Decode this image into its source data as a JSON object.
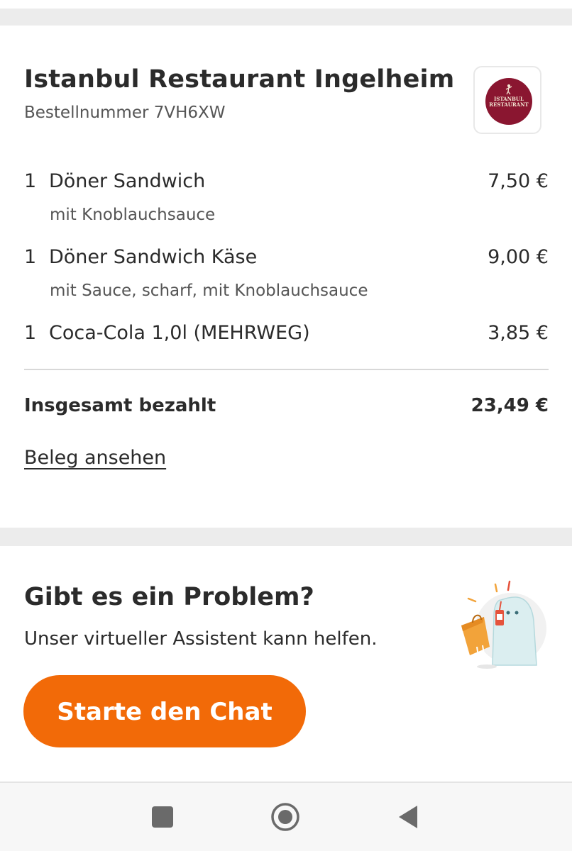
{
  "order": {
    "restaurant_name": "Istanbul Restaurant Ingelheim",
    "order_number_label": "Bestellnummer 7VH6XW",
    "logo_text_line1": "ISTANBUL",
    "logo_text_line2": "RESTAURANT",
    "items": [
      {
        "qty": "1",
        "name": "Döner Sandwich",
        "price": "7,50 €",
        "note": "mit Knoblauchsauce"
      },
      {
        "qty": "1",
        "name": "Döner Sandwich Käse",
        "price": "9,00 €",
        "note": "mit Sauce, scharf, mit Knoblauchsauce"
      },
      {
        "qty": "1",
        "name": "Coca-Cola 1,0l (MEHRWEG)",
        "price": "3,85 €",
        "note": ""
      }
    ],
    "total_label": "Insgesamt bezahlt",
    "total_value": "23,49 €",
    "receipt_link": "Beleg ansehen"
  },
  "help": {
    "title": "Gibt es ein Problem?",
    "subtitle": "Unser virtueller Assistent kann helfen.",
    "chat_button": "Starte den Chat"
  },
  "colors": {
    "accent": "#f26a08",
    "logo_background": "#8a1630",
    "section_gap": "#ececec"
  },
  "nav": {
    "icons": [
      "recents-square-icon",
      "home-circle-icon",
      "back-triangle-icon"
    ]
  }
}
